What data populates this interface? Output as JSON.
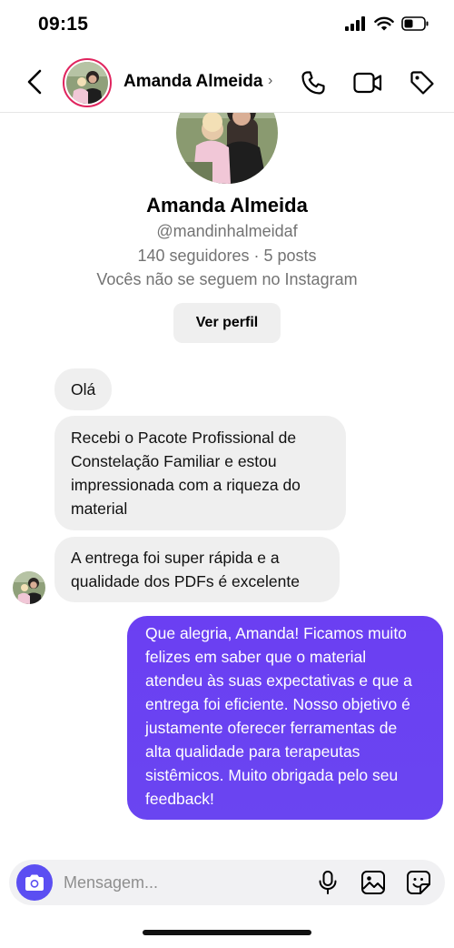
{
  "status_bar": {
    "time": "09:15"
  },
  "header": {
    "name": "Amanda Almeida",
    "chevron": "›"
  },
  "profile": {
    "name": "Amanda Almeida",
    "handle": "@mandinhalmeidaf",
    "stats": "140 seguidores · 5 posts",
    "follow_status": "Vocês não se seguem no Instagram",
    "view_profile_label": "Ver perfil"
  },
  "messages": [
    {
      "direction": "incoming",
      "text": "Olá"
    },
    {
      "direction": "incoming",
      "text": "Recebi o Pacote Profissional de Constelação Familiar e estou impressionada com a riqueza do material"
    },
    {
      "direction": "incoming",
      "text": "A entrega foi super rápida e a qualidade dos PDFs é excelente"
    },
    {
      "direction": "outgoing",
      "text": " Que alegria, Amanda! Ficamos muito felizes em saber que o material atendeu às suas expectativas e que a entrega foi eficiente. Nosso objetivo é justamente oferecer ferramentas de alta qualidade para terapeutas sistêmicos. Muito obrigada pelo seu feedback!"
    }
  ],
  "composer": {
    "placeholder": "Mensagem..."
  },
  "icons": {
    "back": "back-icon",
    "phone": "phone-icon",
    "video": "video-icon",
    "tag": "tag-icon",
    "camera": "camera-icon",
    "mic": "microphone-icon",
    "gallery": "gallery-icon",
    "sticker": "sticker-icon"
  },
  "colors": {
    "accent": "#6b3ff2",
    "camera_button": "#5b4ef2",
    "incoming_bubble": "#efefef",
    "story_ring": "#e0245e"
  }
}
